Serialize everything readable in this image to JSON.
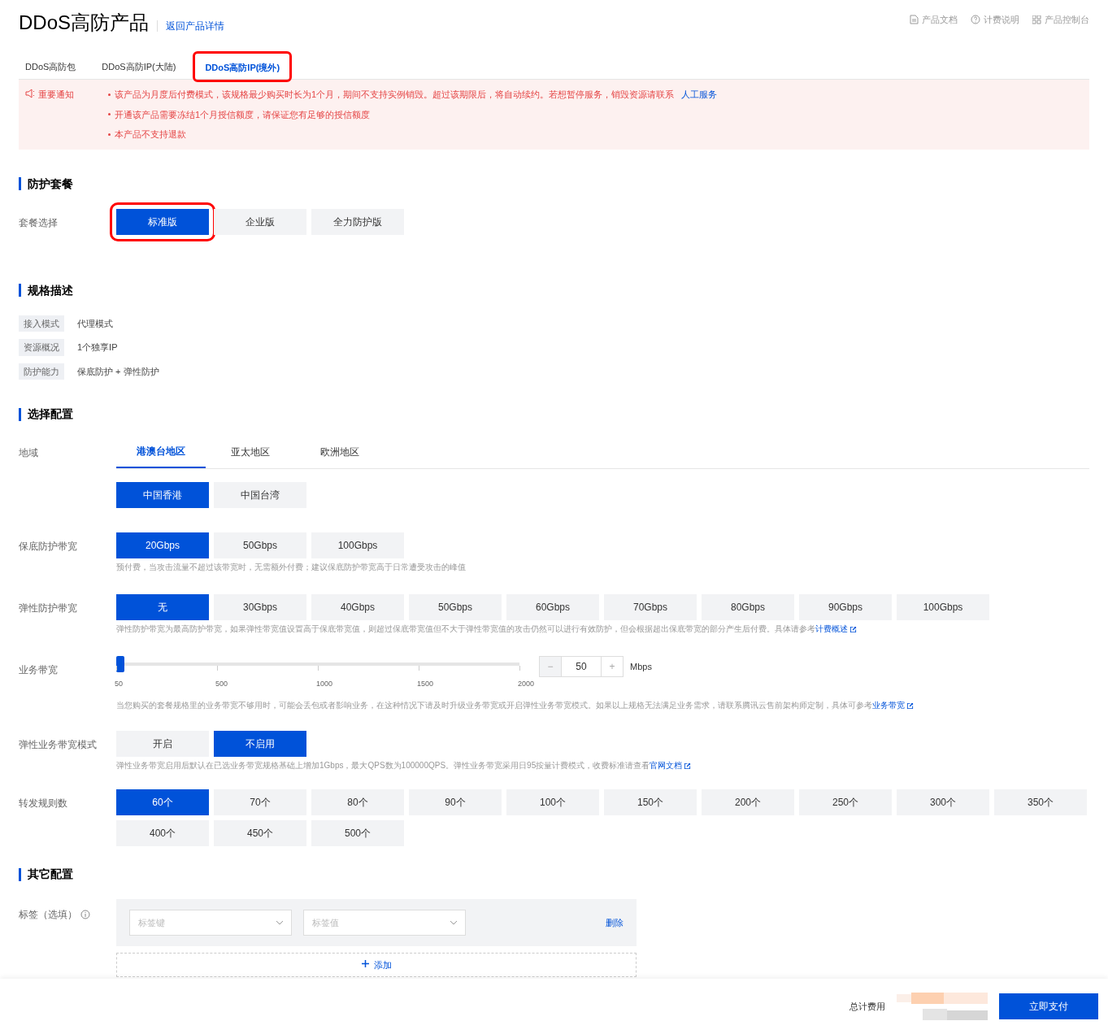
{
  "header": {
    "title": "DDoS高防产品",
    "back_link": "返回产品详情",
    "links": [
      {
        "kind": "doc",
        "label": "产品文档"
      },
      {
        "kind": "help",
        "label": "计费说明"
      },
      {
        "kind": "grid",
        "label": "产品控制台"
      }
    ]
  },
  "tabs": [
    {
      "label": "DDoS高防包",
      "selected": false
    },
    {
      "label": "DDoS高防IP(大陆)",
      "selected": false
    },
    {
      "label": "DDoS高防IP(境外)",
      "selected": true
    }
  ],
  "notice": {
    "label": "重要通知",
    "items": [
      {
        "text": "该产品为月度后付费模式，该规格最少购买时长为1个月，期间不支持实例销毁。超过该期限后，将自动续约。若想暂停服务，销毁资源请联系",
        "link": "人工服务"
      },
      {
        "text": "开通该产品需要冻结1个月授信额度，请保证您有足够的授信额度"
      },
      {
        "text": "本产品不支持退款"
      }
    ]
  },
  "package": {
    "heading": "防护套餐",
    "label": "套餐选择",
    "options": [
      {
        "label": "标准版",
        "selected": true
      },
      {
        "label": "企业版",
        "selected": false
      },
      {
        "label": "全力防护版",
        "selected": false
      }
    ]
  },
  "spec": {
    "heading": "规格描述",
    "rows": [
      {
        "key": "接入模式",
        "value": "代理模式"
      },
      {
        "key": "资源概况",
        "value": "1个独享IP"
      },
      {
        "key": "防护能力",
        "value": "保底防护 + 弹性防护"
      }
    ]
  },
  "config": {
    "heading": "选择配置",
    "region": {
      "label": "地域",
      "tabs": [
        {
          "label": "港澳台地区",
          "selected": true
        },
        {
          "label": "亚太地区",
          "selected": false
        },
        {
          "label": "欧洲地区",
          "selected": false
        }
      ],
      "options": [
        {
          "label": "中国香港",
          "selected": true
        },
        {
          "label": "中国台湾",
          "selected": false
        }
      ]
    },
    "base_bandwidth": {
      "label": "保底防护带宽",
      "options": [
        {
          "label": "20Gbps",
          "selected": true
        },
        {
          "label": "50Gbps",
          "selected": false
        },
        {
          "label": "100Gbps",
          "selected": false
        }
      ],
      "hint": "预付费，当攻击流量不超过该带宽时，无需额外付费；建议保底防护带宽高于日常遭受攻击的峰值"
    },
    "elastic_bandwidth": {
      "label": "弹性防护带宽",
      "options": [
        {
          "label": "无",
          "selected": true
        },
        {
          "label": "30Gbps",
          "selected": false
        },
        {
          "label": "40Gbps",
          "selected": false
        },
        {
          "label": "50Gbps",
          "selected": false
        },
        {
          "label": "60Gbps",
          "selected": false
        },
        {
          "label": "70Gbps",
          "selected": false
        },
        {
          "label": "80Gbps",
          "selected": false
        },
        {
          "label": "90Gbps",
          "selected": false
        },
        {
          "label": "100Gbps",
          "selected": false
        }
      ],
      "hint": "弹性防护带宽为最高防护带宽，如果弹性带宽值设置高于保底带宽值，则超过保底带宽值但不大于弹性带宽值的攻击仍然可以进行有效防护，但会根据超出保底带宽的部分产生后付费。具体请参考",
      "hint_link": "计费概述"
    },
    "business_bandwidth": {
      "label": "业务带宽",
      "level": 0,
      "ticks": [
        "50",
        "500",
        "1000",
        "1500",
        "2000"
      ],
      "decrement": "−",
      "value": "50",
      "increment": "+",
      "unit": "Mbps",
      "hint": "当您购买的套餐规格里的业务带宽不够用时，可能会丢包或者影响业务，在这种情况下请及时升级业务带宽或开启弹性业务带宽模式。如果以上规格无法满足业务需求，请联系腾讯云售前架构师定制，具体可参考",
      "hint_link": "业务带宽"
    },
    "elastic_business": {
      "label": "弹性业务带宽模式",
      "options": [
        {
          "label": "开启",
          "selected": false
        },
        {
          "label": "不启用",
          "selected": true
        }
      ],
      "hint": "弹性业务带宽启用后默认在已选业务带宽规格基础上增加1Gbps，最大QPS数为100000QPS。弹性业务带宽采用日95按量计费模式，收费标准请查看",
      "hint_link": "官网文档"
    },
    "rules": {
      "label": "转发规则数",
      "options": [
        {
          "label": "60个",
          "selected": true
        },
        {
          "label": "70个",
          "selected": false
        },
        {
          "label": "80个",
          "selected": false
        },
        {
          "label": "90个",
          "selected": false
        },
        {
          "label": "100个",
          "selected": false
        },
        {
          "label": "150个",
          "selected": false
        },
        {
          "label": "200个",
          "selected": false
        },
        {
          "label": "250个",
          "selected": false
        },
        {
          "label": "300个",
          "selected": false
        },
        {
          "label": "350个",
          "selected": false
        },
        {
          "label": "400个",
          "selected": false
        },
        {
          "label": "450个",
          "selected": false
        },
        {
          "label": "500个",
          "selected": false
        }
      ]
    }
  },
  "other": {
    "heading": "其它配置",
    "tag_label": "标签（选填）",
    "key_placeholder": "标签键",
    "value_placeholder": "标签值",
    "delete": "删除",
    "add": "添加"
  },
  "footer": {
    "total_label": "总计费用",
    "pay": "立即支付"
  },
  "highlights": {
    "tab": true,
    "package": true
  }
}
